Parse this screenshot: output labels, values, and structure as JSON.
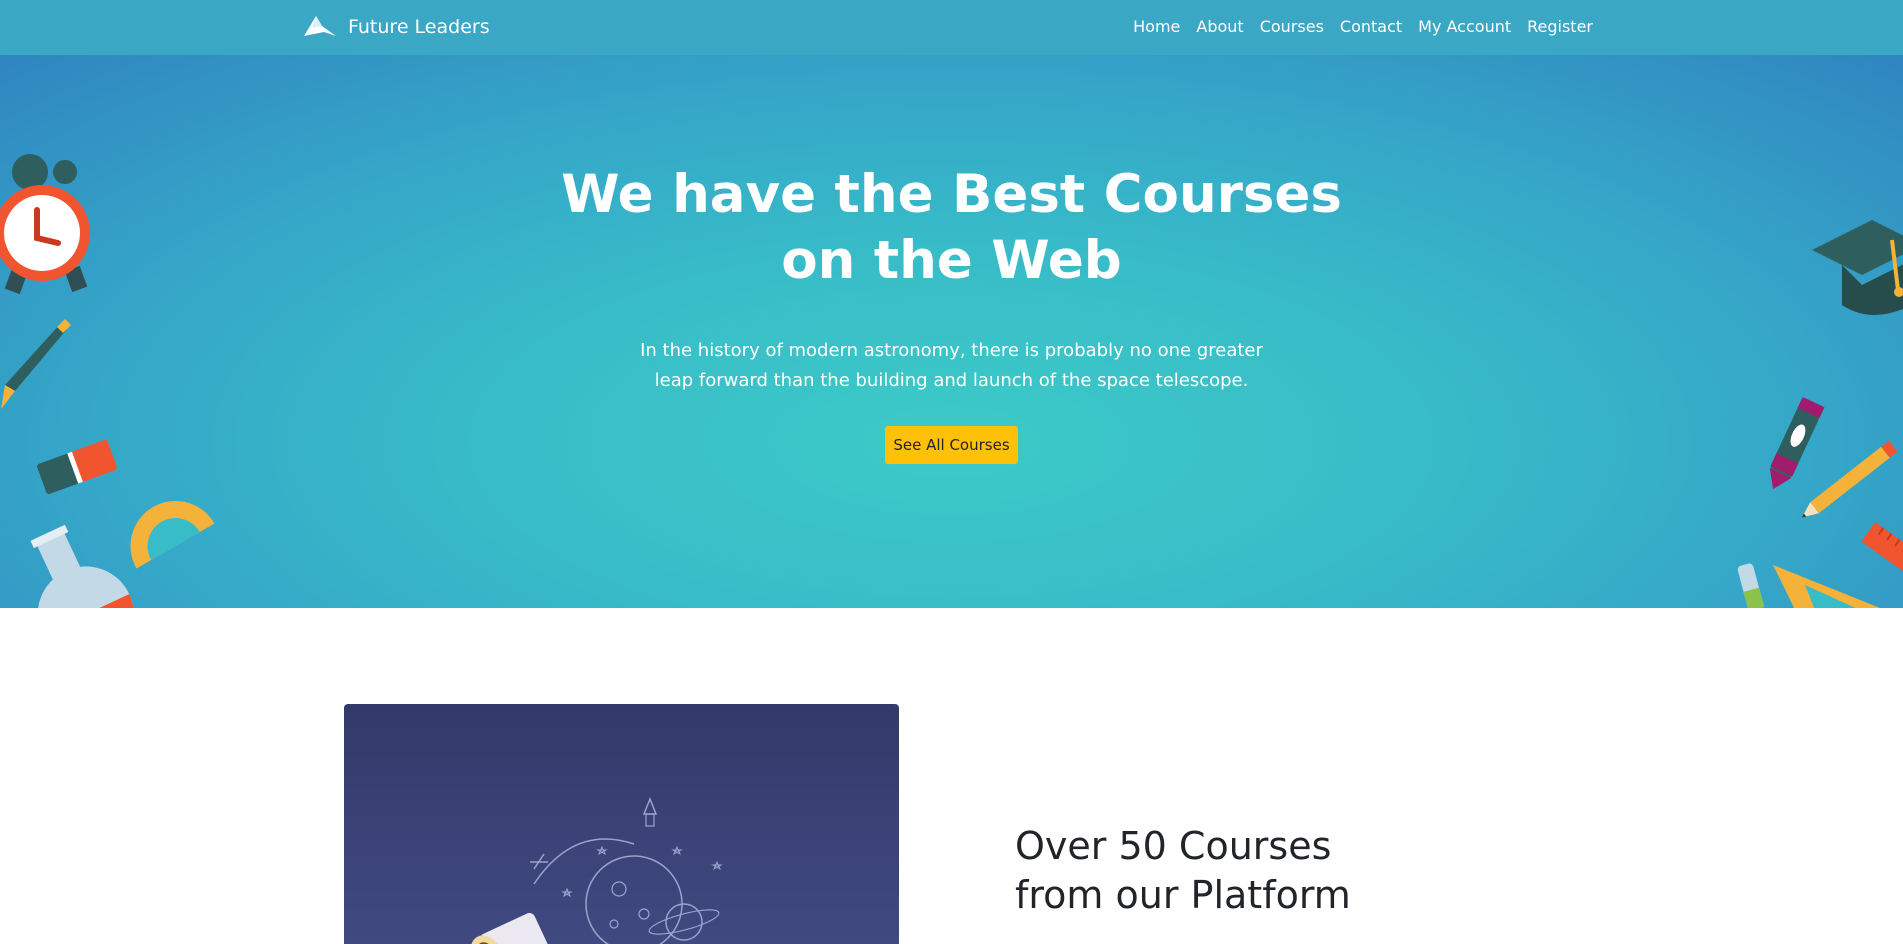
{
  "brand": {
    "name": "Future Leaders",
    "logo_icon": "paper-plane-logo-icon"
  },
  "nav": {
    "items": [
      {
        "label": "Home"
      },
      {
        "label": "About"
      },
      {
        "label": "Courses"
      },
      {
        "label": "Contact"
      },
      {
        "label": "My Account"
      },
      {
        "label": "Register"
      }
    ]
  },
  "hero": {
    "title_line1": "We have the Best Courses",
    "title_line2": "on the Web",
    "text_line1": "In the history of modern astronomy, there is probably no one greater",
    "text_line2": "leap forward than the building and launch of the space telescope.",
    "button_label": "See All Courses",
    "decorations": [
      "alarm-clock-icon",
      "fountain-pen-icon",
      "eraser-icon",
      "protractor-icon",
      "flask-icon",
      "test-tube-icon",
      "graduation-cap-icon",
      "crayon-icon",
      "pencil-icon",
      "ruler-icon",
      "set-square-icon"
    ]
  },
  "feature": {
    "heading_line1": "Over 50 Courses",
    "heading_line2": "from our Platform",
    "illustration_icon": "telescope-space-illustration"
  },
  "colors": {
    "navbar": "#3aa8c4",
    "hero_center": "#3ccac7",
    "hero_edge": "#3085c0",
    "cta": "#ffc107",
    "feature_image": "#323a6a"
  }
}
